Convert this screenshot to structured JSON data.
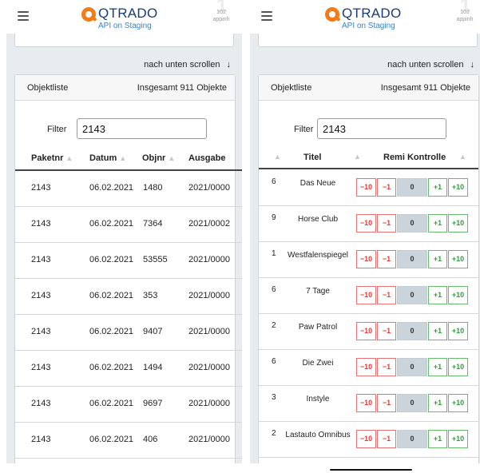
{
  "app": {
    "brand": "QTRADO",
    "subtitle": "API on Staging",
    "badge_number": "102",
    "badge_text": "appinh"
  },
  "scroll_label": "nach unten scrollen",
  "scroll_arrow": "↓",
  "list": {
    "title": "Objektliste",
    "total": "Insgesamt 911 Objekte"
  },
  "filter": {
    "label": "Filter",
    "value": "2143"
  },
  "left_table": {
    "columns": [
      "Paketnr",
      "Datum",
      "Objnr",
      "Ausgabe"
    ],
    "rows": [
      [
        "2143",
        "06.02.2021",
        "1480",
        "2021/0000"
      ],
      [
        "2143",
        "06.02.2021",
        "7364",
        "2021/0002"
      ],
      [
        "2143",
        "06.02.2021",
        "53555",
        "2021/0000"
      ],
      [
        "2143",
        "06.02.2021",
        "353",
        "2021/0000"
      ],
      [
        "2143",
        "06.02.2021",
        "9407",
        "2021/0000"
      ],
      [
        "2143",
        "06.02.2021",
        "1494",
        "2021/0000"
      ],
      [
        "2143",
        "06.02.2021",
        "9697",
        "2021/0000"
      ],
      [
        "2143",
        "06.02.2021",
        "406",
        "2021/0000"
      ]
    ]
  },
  "right_table": {
    "columns": [
      "Titel",
      "Remi Kontrolle"
    ],
    "buttons": [
      "−10",
      "−1",
      "0",
      "+1",
      "+10"
    ],
    "rows": [
      {
        "count": "6",
        "title": "Das Neue"
      },
      {
        "count": "9",
        "title": "Horse Club"
      },
      {
        "count": "1",
        "title": "Westfalenspiegel"
      },
      {
        "count": "6",
        "title": "7 Tage"
      },
      {
        "count": "2",
        "title": "Paw Patrol"
      },
      {
        "count": "6",
        "title": "Die Zwei"
      },
      {
        "count": "3",
        "title": "Instyle"
      },
      {
        "count": "2",
        "title": "Lastauto Omnibus"
      }
    ]
  }
}
